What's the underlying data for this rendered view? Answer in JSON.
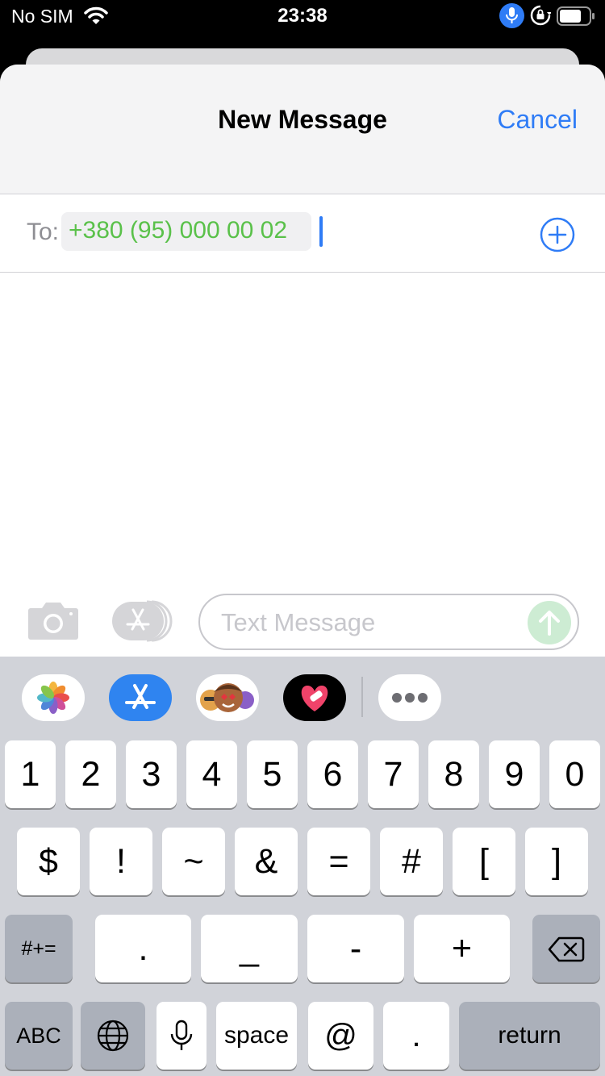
{
  "status_bar": {
    "carrier": "No SIM",
    "time": "23:38",
    "icons": [
      "wifi-icon",
      "microphone-icon",
      "orientation-lock-icon",
      "battery-icon"
    ]
  },
  "compose": {
    "title": "New Message",
    "cancel_label": "Cancel",
    "to_label": "To:",
    "recipient": "+380 (95) 000 00 02",
    "message_placeholder": "Text Message"
  },
  "app_strip": [
    "photos-app-icon",
    "app-store-icon",
    "memoji-stickers-icon",
    "digital-touch-icon",
    "more-apps-icon"
  ],
  "keyboard": {
    "row1": [
      "1",
      "2",
      "3",
      "4",
      "5",
      "6",
      "7",
      "8",
      "9",
      "0"
    ],
    "row2": [
      "$",
      "!",
      "~",
      "&",
      "=",
      "#",
      "[",
      "]"
    ],
    "row3": {
      "shift": "#+=",
      "keys": [
        ".",
        "_",
        "-",
        "+"
      ]
    },
    "row4": {
      "abc": "ABC",
      "space": "space",
      "at": "@",
      "dot": ".",
      "return": "return"
    }
  },
  "colors": {
    "accent": "#2f7cf6",
    "recipient_green": "#5ac14a",
    "keyboard_bg": "#d1d3d9"
  }
}
